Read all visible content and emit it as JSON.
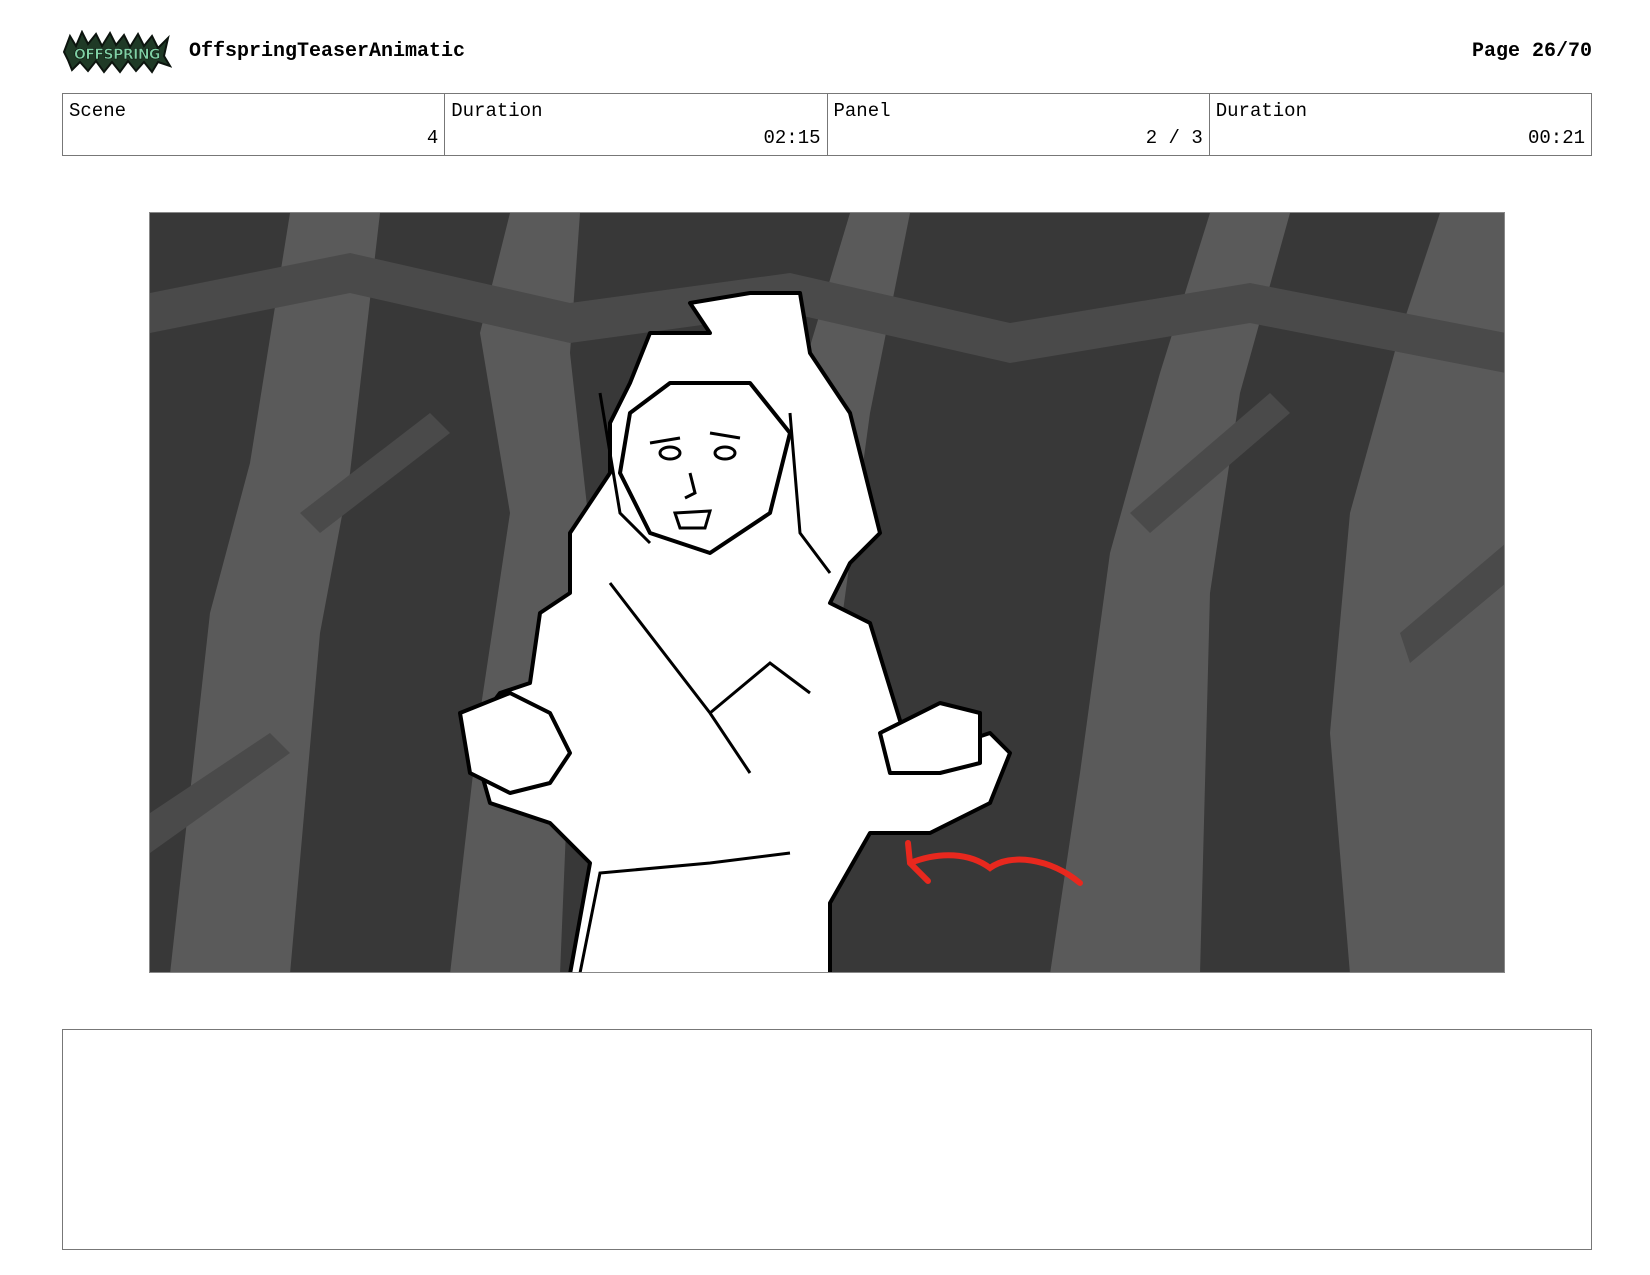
{
  "header": {
    "logo_text": "OFFSPRING",
    "project_title": "OffspringTeaserAnimatic",
    "page_label": "Page 26/70"
  },
  "info": {
    "scene_label": "Scene",
    "scene_value": "4",
    "scene_duration_label": "Duration",
    "scene_duration_value": "02:15",
    "panel_label": "Panel",
    "panel_value": "2 / 3",
    "panel_duration_label": "Duration",
    "panel_duration_value": "00:21"
  },
  "panel": {
    "arrow_color": "#e8281e",
    "background_tone": "#3a3a3a"
  },
  "notes": {
    "text": ""
  }
}
